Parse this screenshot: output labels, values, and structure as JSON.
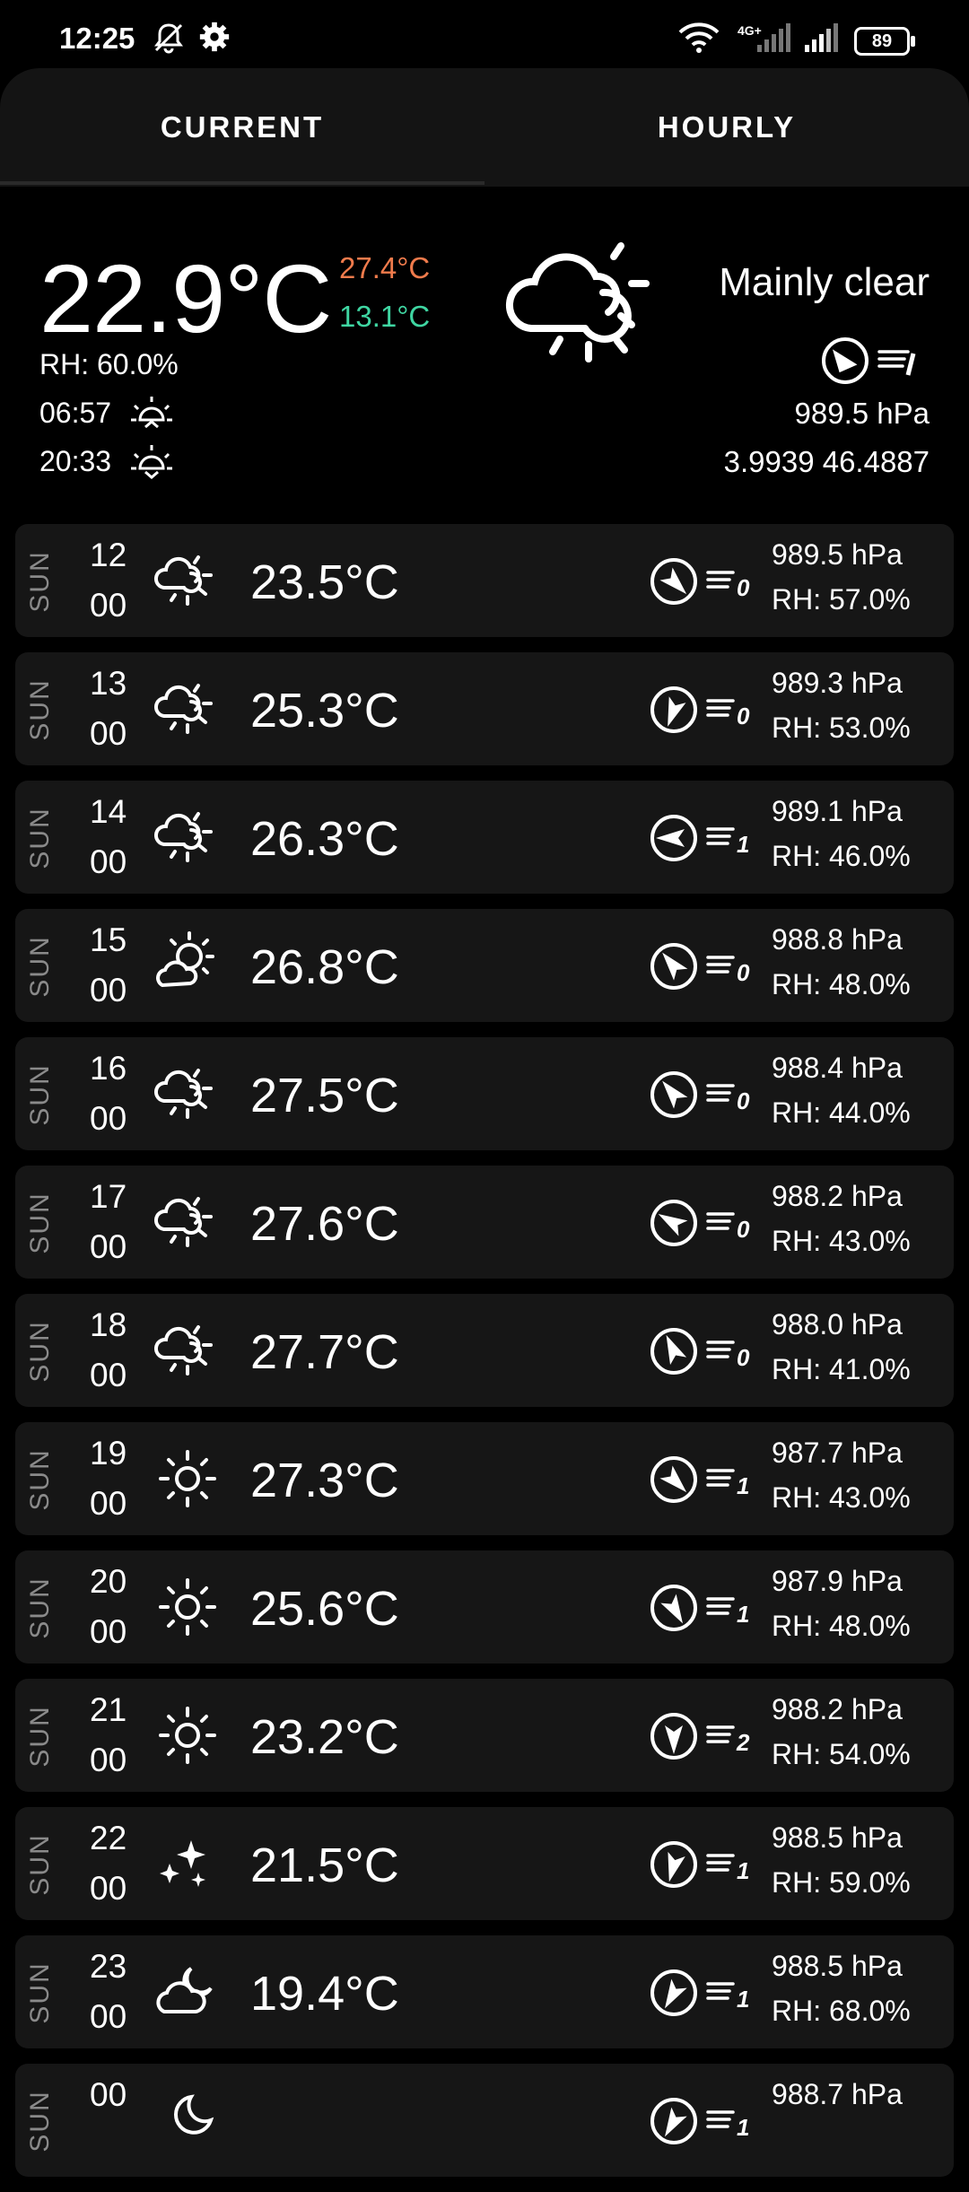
{
  "status_bar": {
    "time": "12:25",
    "battery": "89",
    "network": "4G+",
    "icons": [
      "bell-muted-icon",
      "gear-icon",
      "wifi-icon",
      "signal-icon",
      "signal-icon",
      "battery-icon"
    ]
  },
  "tabs": [
    {
      "label": "CURRENT",
      "selected": true
    },
    {
      "label": "HOURLY",
      "selected": false
    }
  ],
  "current": {
    "temperature": "22.9°C",
    "max": "27.4°C",
    "min": "13.1°C",
    "humidity": "RH: 60.0%",
    "sunrise": "06:57",
    "sunset": "20:33",
    "condition": "Mainly clear",
    "condition_icon": "partly-cloudy-icon",
    "pressure": "989.5 hPa",
    "coordinates": "3.9939 46.4887",
    "wind_direction_icon": "wind-direction-icon",
    "wind_speed_icon": "wind-speed-icon",
    "colors": {
      "max": "#f07b4c",
      "min": "#3fd6a2"
    }
  },
  "hourly": [
    {
      "day": "SUN",
      "hour": "12",
      "min": "00",
      "icon": "partly-cloudy-icon",
      "temp": "23.5°C",
      "wind_dir_deg": 135,
      "wind_force": "0",
      "pressure": "989.5 hPa",
      "rh": "RH: 57.0%"
    },
    {
      "day": "SUN",
      "hour": "13",
      "min": "00",
      "icon": "partly-cloudy-icon",
      "temp": "25.3°C",
      "wind_dir_deg": 200,
      "wind_force": "0",
      "pressure": "989.3 hPa",
      "rh": "RH: 53.0%"
    },
    {
      "day": "SUN",
      "hour": "14",
      "min": "00",
      "icon": "partly-cloudy-icon",
      "temp": "26.3°C",
      "wind_dir_deg": 270,
      "wind_force": "1",
      "pressure": "989.1 hPa",
      "rh": "RH: 46.0%"
    },
    {
      "day": "SUN",
      "hour": "15",
      "min": "00",
      "icon": "sun-cloud-icon",
      "temp": "26.8°C",
      "wind_dir_deg": 320,
      "wind_force": "0",
      "pressure": "988.8 hPa",
      "rh": "RH: 48.0%"
    },
    {
      "day": "SUN",
      "hour": "16",
      "min": "00",
      "icon": "partly-cloudy-icon",
      "temp": "27.5°C",
      "wind_dir_deg": 320,
      "wind_force": "0",
      "pressure": "988.4 hPa",
      "rh": "RH: 44.0%"
    },
    {
      "day": "SUN",
      "hour": "17",
      "min": "00",
      "icon": "partly-cloudy-icon",
      "temp": "27.6°C",
      "wind_dir_deg": 300,
      "wind_force": "0",
      "pressure": "988.2 hPa",
      "rh": "RH: 43.0%"
    },
    {
      "day": "SUN",
      "hour": "18",
      "min": "00",
      "icon": "partly-cloudy-icon",
      "temp": "27.7°C",
      "wind_dir_deg": 335,
      "wind_force": "0",
      "pressure": "988.0 hPa",
      "rh": "RH: 41.0%"
    },
    {
      "day": "SUN",
      "hour": "19",
      "min": "00",
      "icon": "sun-icon",
      "temp": "27.3°C",
      "wind_dir_deg": 135,
      "wind_force": "1",
      "pressure": "987.7 hPa",
      "rh": "RH: 43.0%"
    },
    {
      "day": "SUN",
      "hour": "20",
      "min": "00",
      "icon": "sun-icon",
      "temp": "25.6°C",
      "wind_dir_deg": 150,
      "wind_force": "1",
      "pressure": "987.9 hPa",
      "rh": "RH: 48.0%"
    },
    {
      "day": "SUN",
      "hour": "21",
      "min": "00",
      "icon": "sun-icon",
      "temp": "23.2°C",
      "wind_dir_deg": 180,
      "wind_force": "2",
      "pressure": "988.2 hPa",
      "rh": "RH: 54.0%"
    },
    {
      "day": "SUN",
      "hour": "22",
      "min": "00",
      "icon": "stars-icon",
      "temp": "21.5°C",
      "wind_dir_deg": 195,
      "wind_force": "1",
      "pressure": "988.5 hPa",
      "rh": "RH: 59.0%"
    },
    {
      "day": "SUN",
      "hour": "23",
      "min": "00",
      "icon": "cloud-moon-icon",
      "temp": "19.4°C",
      "wind_dir_deg": 210,
      "wind_force": "1",
      "pressure": "988.5 hPa",
      "rh": "RH: 68.0%"
    },
    {
      "day": "SUN",
      "hour": "00",
      "min": "",
      "icon": "moon-icon",
      "temp": "",
      "wind_dir_deg": 210,
      "wind_force": "1",
      "pressure": "988.7 hPa",
      "rh": ""
    }
  ]
}
